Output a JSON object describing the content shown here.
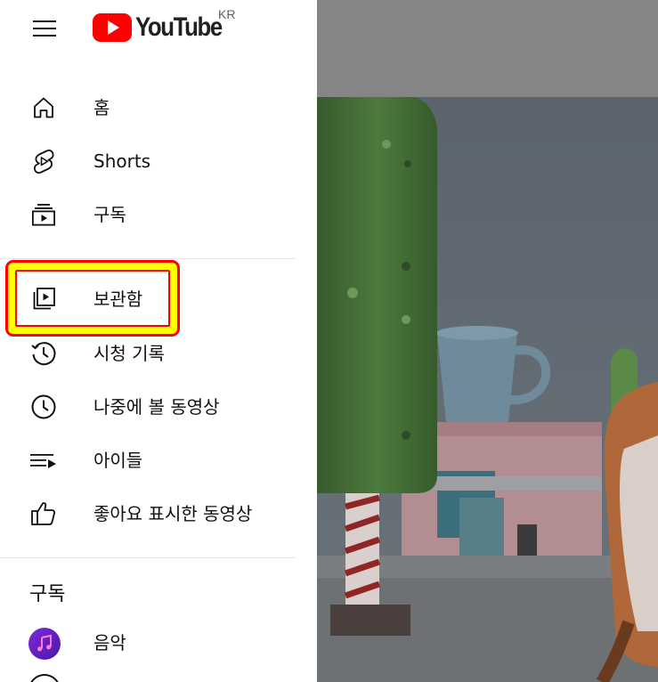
{
  "header": {
    "logo_text": "YouTube",
    "country_code": "KR",
    "menu_icon": "hamburger-menu-icon"
  },
  "nav": {
    "primary": [
      {
        "label": "홈",
        "icon": "home-icon"
      },
      {
        "label": "Shorts",
        "icon": "shorts-icon"
      },
      {
        "label": "구독",
        "icon": "subscriptions-icon"
      }
    ],
    "library": [
      {
        "label": "보관함",
        "icon": "library-icon"
      },
      {
        "label": "시청 기록",
        "icon": "history-icon"
      },
      {
        "label": "나중에 볼 동영상",
        "icon": "watch-later-icon"
      },
      {
        "label": "아이들",
        "icon": "playlist-icon"
      },
      {
        "label": "좋아요 표시한 동영상",
        "icon": "like-icon"
      }
    ],
    "subscriptions_title": "구독",
    "subscriptions": [
      {
        "label": "음악",
        "icon": "music-channel-avatar"
      }
    ]
  },
  "colors": {
    "brand_red": "#ff0000",
    "highlight_yellow": "#ffff00",
    "text": "#0f0f0f",
    "divider": "#e5e5e5",
    "music_avatar": "#6a1fc9"
  }
}
